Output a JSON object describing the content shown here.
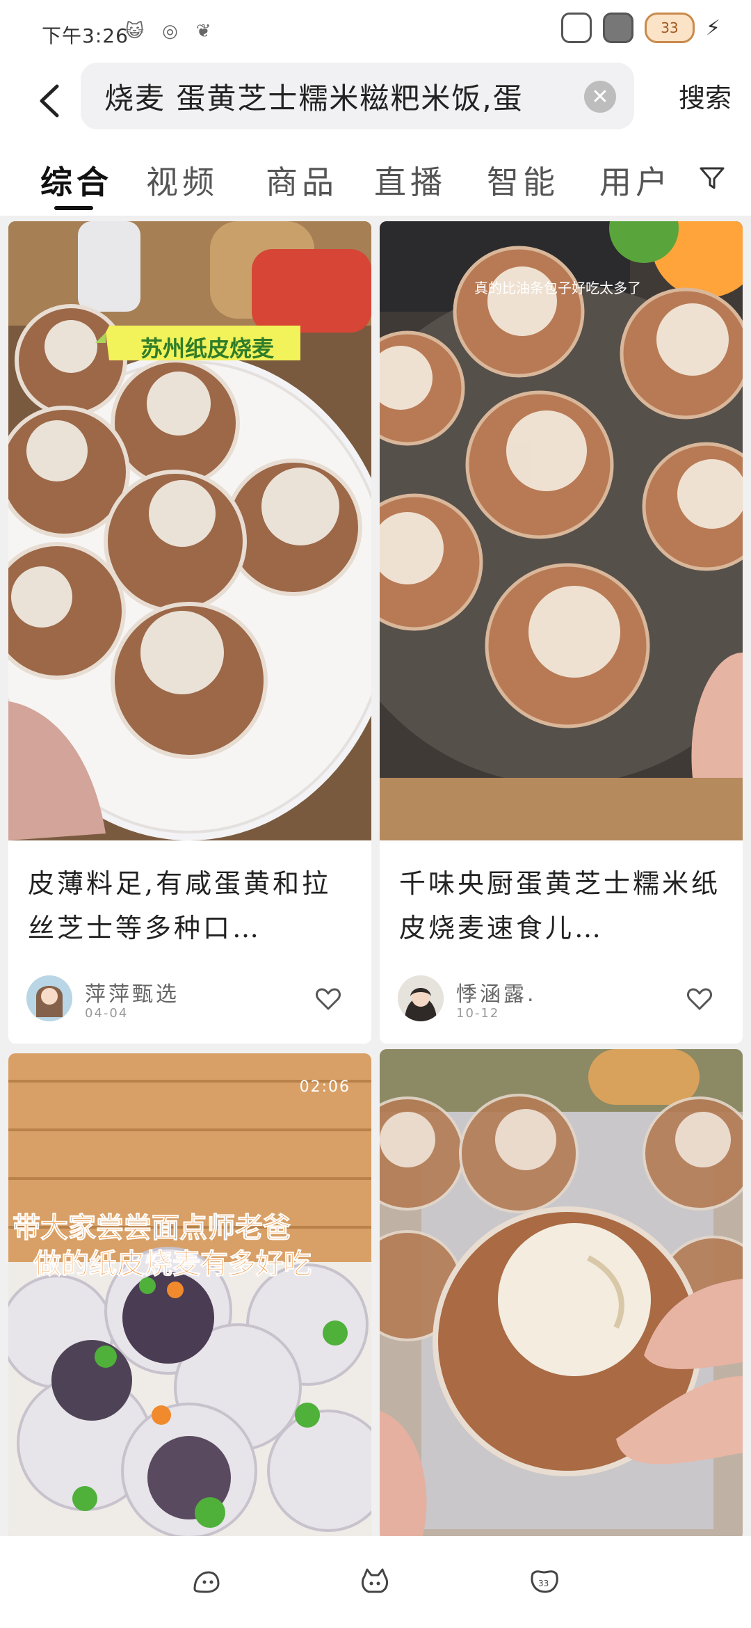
{
  "status": {
    "time": "下午3:26"
  },
  "header": {
    "search_value": "烧麦 蛋黄芝士糯米糍粑米饭,蛋",
    "search_button": "搜索"
  },
  "tabs": [
    {
      "label": "综合",
      "active": true
    },
    {
      "label": "视频",
      "active": false
    },
    {
      "label": "商品",
      "active": false
    },
    {
      "label": "直播",
      "active": false
    },
    {
      "label": "智能",
      "active": false
    },
    {
      "label": "用户",
      "active": false
    }
  ],
  "feed": {
    "cards": [
      {
        "image_text": "苏州纸皮烧麦",
        "title": "皮薄料足,有咸蛋黄和拉丝芝士等多种口…",
        "author": "萍萍甄选",
        "date": "04-04"
      },
      {
        "image_text": "真的比油条包子好吃太多了",
        "title": "千味央厨蛋黄芝士糯米纸皮烧麦速食儿…",
        "author": "悸涵露.",
        "date": "10-12"
      },
      {
        "duration": "02:06",
        "image_text_line1": "带大家尝尝面点师老爸",
        "image_text_line2": "做的纸皮烧麦有多好吃"
      },
      {}
    ]
  },
  "colors": {
    "accent_text": "#111111",
    "overlay_yellow": "#f2f25a",
    "overlay_orange": "#f08a2c"
  }
}
